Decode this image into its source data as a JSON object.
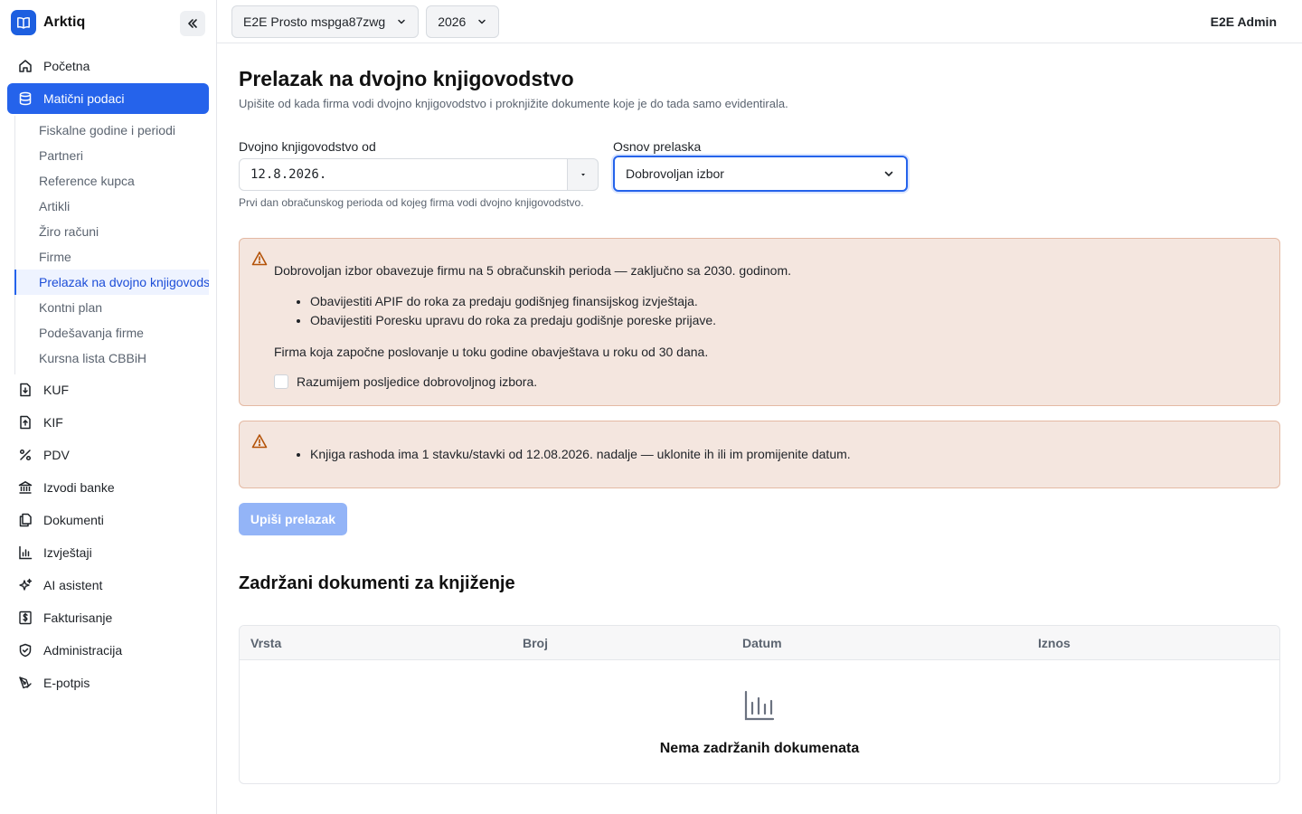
{
  "app": {
    "name": "Arktiq"
  },
  "sidebar": {
    "primary": [
      {
        "label": "Početna",
        "icon": "home-icon"
      },
      {
        "label": "Matični podaci",
        "icon": "database-icon",
        "active": true
      }
    ],
    "sub": [
      "Fiskalne godine i periodi",
      "Partneri",
      "Reference kupca",
      "Artikli",
      "Žiro računi",
      "Firme",
      "Prelazak na dvojno knjigovodstvo",
      "Kontni plan",
      "Podešavanja firme",
      "Kursna lista CBBiH"
    ],
    "sub_active_index": 6,
    "secondary": [
      {
        "label": "KUF",
        "icon": "file-in-icon"
      },
      {
        "label": "KIF",
        "icon": "file-out-icon"
      },
      {
        "label": "PDV",
        "icon": "percent-icon"
      },
      {
        "label": "Izvodi banke",
        "icon": "bank-icon"
      },
      {
        "label": "Dokumenti",
        "icon": "documents-icon"
      },
      {
        "label": "Izvještaji",
        "icon": "bar-chart-icon"
      },
      {
        "label": "AI asistent",
        "icon": "sparkles-icon"
      },
      {
        "label": "Fakturisanje",
        "icon": "invoice-dollar-icon"
      },
      {
        "label": "Administracija",
        "icon": "shield-icon"
      },
      {
        "label": "E-potpis",
        "icon": "signature-pen-icon"
      }
    ]
  },
  "topbar": {
    "company": "E2E Prosto mspga87zwg",
    "year": "2026",
    "user": "E2E Admin"
  },
  "page": {
    "title": "Prelazak na dvojno knjigovodstvo",
    "subtitle": "Upišite od kada firma vodi dvojno knjigovodstvo i proknjižite dokumente koje je do tada samo evidentirala."
  },
  "form": {
    "date_label": "Dvojno knjigovodstvo od",
    "date_value": "12.8.2026.",
    "date_help": "Prvi dan obračunskog perioda od kojeg firma vodi dvojno knjigovodstvo.",
    "basis_label": "Osnov prelaska",
    "basis_value": "Dobrovoljan izbor"
  },
  "alert1": {
    "text": "Dobrovoljan izbor obavezuje firmu na 5 obračunskih perioda — zaključno sa 2030. godinom.",
    "items": [
      "Obavijestiti APIF do roka za predaju godišnjeg finansijskog izvještaja.",
      "Obavijestiti Poresku upravu do roka za predaju godišnje poreske prijave."
    ],
    "note": "Firma koja započne poslovanje u toku godine obavještava u roku od 30 dana.",
    "checkbox_label": "Razumijem posljedice dobrovoljnog izbora.",
    "checked": false
  },
  "alert2": {
    "items": [
      "Knjiga rashoda ima 1 stavku/stavki od 12.08.2026. nadalje — uklonite ih ili im promijenite datum."
    ]
  },
  "submit_label": "Upiši prelazak",
  "held": {
    "title": "Zadržani dokumenti za knjiženje",
    "columns": [
      "Vrsta",
      "Broj",
      "Datum",
      "Iznos"
    ],
    "empty_text": "Nema zadržanih dokumenata"
  },
  "colors": {
    "accent": "#2563eb",
    "warning_bg": "#f4e6df",
    "warning_border": "#e4b9a3",
    "warning_icon": "#b45309"
  }
}
